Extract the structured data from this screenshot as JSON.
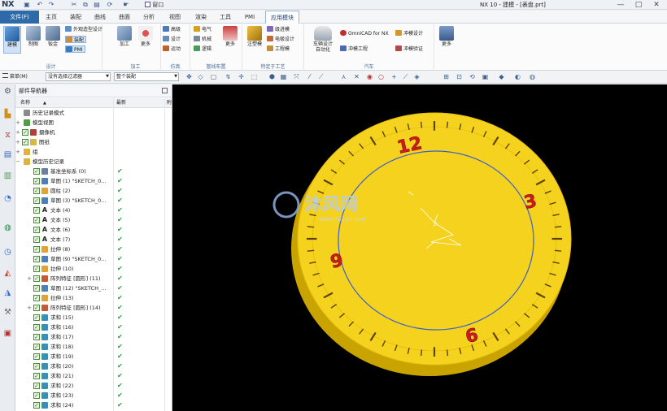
{
  "titlebar": {
    "logo": "NX",
    "window_menu": "窗口",
    "title": "NX 10 - 建模 - [表盘.prt]",
    "controls": [
      "—",
      "□",
      "✕"
    ]
  },
  "tabs": {
    "file": "文件(F)",
    "items": [
      "主页",
      "装配",
      "曲线",
      "曲面",
      "分析",
      "视图",
      "渲染",
      "工具",
      "PMI",
      "应用模块"
    ],
    "active": "应用模块"
  },
  "ribbon": {
    "groups": {
      "design": "设计",
      "process": "加工",
      "sim": "仿真",
      "pipe": "管线布置",
      "special": "特定于工艺",
      "auto": "汽车"
    },
    "buttons": {
      "modeling": "建模",
      "drafting": "制图",
      "sheetmetal": "钣金",
      "shape_studio": "外观造型设计",
      "assembly": "装配",
      "pmi": "PMI",
      "machining": "加工",
      "more1": "更多",
      "advanced": "高级",
      "design2": "设计",
      "motion": "运动",
      "electrical": "电气",
      "mechanical": "机械",
      "logical": "逻辑",
      "more2": "更多",
      "mold": "注塑模",
      "progressive_die": "级进模",
      "electrode": "电极设计",
      "engineering_die": "工程模",
      "vehicle_design": "车辆设计",
      "automation": "自动化",
      "omnicad": "OmniCAD for NX",
      "stamping_eng": "冲模工程",
      "stamping_design": "冲模设计",
      "stamping_validate": "冲模验证",
      "more3": "更多"
    }
  },
  "toolbar": {
    "menu": "菜单(M)",
    "filter": "没有选择过滤器",
    "scope": "整个装配"
  },
  "navigator": {
    "title": "部件导航器",
    "col_name": "名称",
    "col_update": "最新",
    "col_extra": "附",
    "rows": [
      {
        "text": "历史记录模式",
        "level": 0,
        "exp": "",
        "check": false,
        "icon": "#8a8a8a",
        "update": ""
      },
      {
        "text": "模型视图",
        "level": 0,
        "exp": "+",
        "check": false,
        "icon": "#4f9e46",
        "update": ""
      },
      {
        "text": "摄像机",
        "level": 0,
        "exp": "+",
        "check": true,
        "icon": "#b04040",
        "update": ""
      },
      {
        "text": "图纸",
        "level": 0,
        "exp": "+",
        "check": true,
        "icon": "#d9b446",
        "update": ""
      },
      {
        "text": "组",
        "level": 0,
        "exp": "+",
        "check": false,
        "icon": "#e2b23a",
        "update": ""
      },
      {
        "text": "模型历史记录",
        "level": 0,
        "exp": "−",
        "check": false,
        "icon": "#e2b23a",
        "update": ""
      },
      {
        "text": "基准坐标系 (0)",
        "level": 1,
        "exp": "",
        "check": true,
        "icon": "#6b7fa3",
        "update": "✔"
      },
      {
        "text": "草图 (1) \"SKETCH_0...",
        "level": 1,
        "exp": "",
        "check": true,
        "icon": "#4f7fb5",
        "update": "✔"
      },
      {
        "text": "圆柱 (2)",
        "level": 1,
        "exp": "",
        "check": true,
        "icon": "#e0a23a",
        "update": "✔"
      },
      {
        "text": "草图 (3) \"SKETCH_0...",
        "level": 1,
        "exp": "",
        "check": true,
        "icon": "#4f7fb5",
        "update": "✔"
      },
      {
        "text": "文本 (4)",
        "level": 1,
        "exp": "",
        "check": true,
        "icon": "text",
        "update": "✔"
      },
      {
        "text": "文本 (5)",
        "level": 1,
        "exp": "",
        "check": true,
        "icon": "text",
        "update": "✔"
      },
      {
        "text": "文本 (6)",
        "level": 1,
        "exp": "",
        "check": true,
        "icon": "text",
        "update": "✔"
      },
      {
        "text": "文本 (7)",
        "level": 1,
        "exp": "",
        "check": true,
        "icon": "text",
        "update": "✔"
      },
      {
        "text": "拉伸 (8)",
        "level": 1,
        "exp": "",
        "check": true,
        "icon": "#e0a23a",
        "update": "✔"
      },
      {
        "text": "草图 (9) \"SKETCH_0...",
        "level": 1,
        "exp": "",
        "check": true,
        "icon": "#4f7fb5",
        "update": "✔"
      },
      {
        "text": "拉伸 (10)",
        "level": 1,
        "exp": "",
        "check": true,
        "icon": "#e0a23a",
        "update": "✔"
      },
      {
        "text": "阵列特征 [圆形] (11)",
        "level": 1,
        "exp": "+",
        "check": true,
        "icon": "#c05a3a",
        "update": "✔"
      },
      {
        "text": "草图 (12) \"SKETCH_...",
        "level": 1,
        "exp": "",
        "check": true,
        "icon": "#4f7fb5",
        "update": "✔"
      },
      {
        "text": "拉伸 (13)",
        "level": 1,
        "exp": "",
        "check": true,
        "icon": "#e0a23a",
        "update": "✔"
      },
      {
        "text": "阵列特征 [圆形] (14)",
        "level": 1,
        "exp": "+",
        "check": true,
        "icon": "#c05a3a",
        "update": "✔"
      },
      {
        "text": "求和 (15)",
        "level": 1,
        "exp": "",
        "check": true,
        "icon": "#3a8fb5",
        "update": "✔"
      },
      {
        "text": "求和 (16)",
        "level": 1,
        "exp": "",
        "check": true,
        "icon": "#3a8fb5",
        "update": "✔"
      },
      {
        "text": "求和 (17)",
        "level": 1,
        "exp": "",
        "check": true,
        "icon": "#3a8fb5",
        "update": "✔"
      },
      {
        "text": "求和 (18)",
        "level": 1,
        "exp": "",
        "check": true,
        "icon": "#3a8fb5",
        "update": "✔"
      },
      {
        "text": "求和 (19)",
        "level": 1,
        "exp": "",
        "check": true,
        "icon": "#3a8fb5",
        "update": "✔"
      },
      {
        "text": "求和 (20)",
        "level": 1,
        "exp": "",
        "check": true,
        "icon": "#3a8fb5",
        "update": "✔"
      },
      {
        "text": "求和 (21)",
        "level": 1,
        "exp": "",
        "check": true,
        "icon": "#3a8fb5",
        "update": "✔"
      },
      {
        "text": "求和 (22)",
        "level": 1,
        "exp": "",
        "check": true,
        "icon": "#3a8fb5",
        "update": "✔"
      },
      {
        "text": "求和 (23)",
        "level": 1,
        "exp": "",
        "check": true,
        "icon": "#3a8fb5",
        "update": "✔"
      },
      {
        "text": "求和 (24)",
        "level": 1,
        "exp": "",
        "check": true,
        "icon": "#3a8fb5",
        "update": "✔"
      }
    ]
  },
  "graphics": {
    "numerals": [
      "12",
      "3",
      "6",
      "9"
    ],
    "watermark": "沐风网",
    "watermark_url": "www.mfcad.com",
    "face_color": "#f5d21e",
    "edge_color": "#c9a400",
    "circle_color": "#3a5fd0",
    "numeral_color": "#d01b1b"
  }
}
